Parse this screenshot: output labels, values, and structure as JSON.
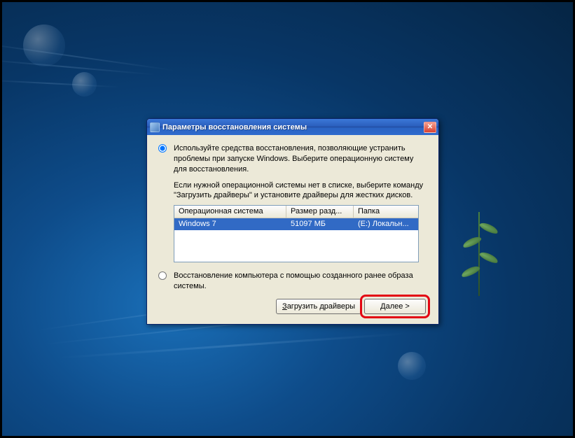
{
  "window": {
    "title": "Параметры восстановления системы"
  },
  "options": {
    "repair": "Используйте средства восстановления, позволяющие устранить проблемы при запуске Windows. Выберите операционную систему для восстановления.",
    "hint": "Если нужной операционной системы нет в списке, выберите команду \"Загрузить драйверы\" и установите драйверы для жестких дисков.",
    "image": "Восстановление компьютера с помощью созданного ранее образа системы."
  },
  "table": {
    "columns": {
      "os": "Операционная система",
      "size": "Размер разд...",
      "folder": "Папка"
    },
    "row": {
      "os": "Windows 7",
      "size": "51097 МБ",
      "folder": "(E:) Локальн..."
    }
  },
  "buttons": {
    "load_drivers": "Загрузить драйверы",
    "next": "Далее >"
  }
}
